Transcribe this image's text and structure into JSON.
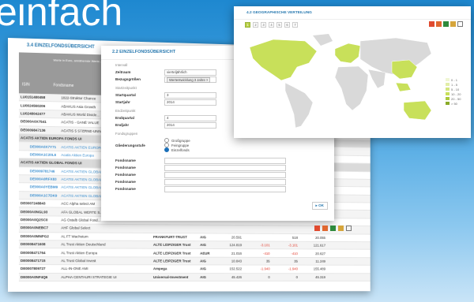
{
  "brand": {
    "text": "einfach"
  },
  "table_panel": {
    "title": "3.4 EINZELFONDSÜBERSICHT",
    "header_note": "Werte in Euro, annähernde Werte...",
    "col_isin": "ISIN",
    "col_name": "Fondsname",
    "rows": [
      {
        "type": "row",
        "isin": "LU0151480458",
        "name": "1822-Struktur Chance",
        "kag": "",
        "cur": "",
        "v1": "",
        "v2": "",
        "v3": "",
        "v4": ""
      },
      {
        "type": "row",
        "isin": "LU0024560206",
        "name": "ABAKUS Asia Growth",
        "kag": "",
        "cur": "",
        "v1": "",
        "v2": "",
        "v3": "",
        "v4": ""
      },
      {
        "type": "row",
        "isin": "LU0248042477",
        "name": "ABAKUS World Divide...",
        "kag": "",
        "cur": "",
        "v1": "",
        "v2": "",
        "v3": "",
        "v4": ""
      },
      {
        "type": "row",
        "isin": "DE000A0X7541",
        "name": "ACATIS - GANÉ VALUE",
        "kag": "",
        "cur": "",
        "v1": "",
        "v2": "",
        "v3": "",
        "v4": ""
      },
      {
        "type": "row",
        "isin": "DE0009847136",
        "name": "ACATIS 5 STERNE-UNIV...",
        "kag": "",
        "cur": "",
        "v1": "",
        "v2": "",
        "v3": "",
        "v4": ""
      },
      {
        "type": "grp",
        "isin": "ACATIS AKTIEN EUROPA FONDS UI"
      },
      {
        "type": "sub",
        "isin": "DE000A0X7Y71",
        "name": "ACATIS AKTIEN EUROPA",
        "kag": "",
        "cur": "",
        "v1": "",
        "v2": "",
        "v3": "",
        "v4": ""
      },
      {
        "type": "sub",
        "isin": "DE000A1C20L6",
        "name": "Acatis Aktien Europa",
        "kag": "",
        "cur": "",
        "v1": "",
        "v2": "",
        "v3": "",
        "v4": ""
      },
      {
        "type": "grp",
        "isin": "ACATIS AKTIEN GLOBAL FONDS UI"
      },
      {
        "type": "sub",
        "isin": "DE0009781746",
        "name": "ACATIS AKTIEN GLOBAL",
        "kag": "",
        "cur": "",
        "v1": "",
        "v2": "",
        "v3": "",
        "v4": ""
      },
      {
        "type": "sub",
        "isin": "DE000A0RFX83",
        "name": "ACATIS AKTIEN GLOBAL",
        "kag": "",
        "cur": "",
        "v1": "",
        "v2": "",
        "v3": "",
        "v4": ""
      },
      {
        "type": "sub",
        "isin": "DE000A0YEBM9",
        "name": "ACATIS AKTIEN GLOBAL",
        "kag": "",
        "cur": "",
        "v1": "",
        "v2": "",
        "v3": "",
        "v4": ""
      },
      {
        "type": "sub",
        "isin": "DE000A1C7DK9",
        "name": "ACATIS AKTIEN GLOBAL",
        "kag": "",
        "cur": "",
        "v1": "",
        "v2": "",
        "v3": "",
        "v4": ""
      },
      {
        "type": "row",
        "isin": "DE0007248843",
        "name": "ACC Alpha select AM",
        "kag": "",
        "cur": "",
        "v1": "",
        "v2": "",
        "v3": "",
        "v4": ""
      },
      {
        "type": "row",
        "isin": "DE000A0NGL93",
        "name": "AFA GLOBAL WERTE S...",
        "kag": "",
        "cur": "",
        "v1": "",
        "v2": "",
        "v3": "",
        "v4": ""
      },
      {
        "type": "row",
        "isin": "DE000A0Q2SC0",
        "name": "AG Ostalb Global Fond...",
        "kag": "",
        "cur": "",
        "v1": "",
        "v2": "",
        "v3": "",
        "v4": ""
      },
      {
        "type": "row",
        "isin": "DE000A0NEBC7",
        "name": "AHF Global Select",
        "kag": "",
        "cur": "",
        "v1": "",
        "v2": "",
        "v3": "",
        "v4": ""
      },
      {
        "type": "row",
        "isin": "DE000A0MNPG2",
        "name": "AL FT Wachstum",
        "kag": "FRANKFURT-TRUST",
        "cur": "AIG",
        "v1": "20.591",
        "v2": "",
        "v3": "518",
        "v4": "20.055"
      },
      {
        "type": "row",
        "isin": "DE0008471608",
        "name": "AL Trust Aktien Deutschland",
        "kag": "ALTE LEIPZIGER Trust",
        "cur": "AIG",
        "v1": "124.819",
        "v2": "-3.101",
        "v3": "-3.101",
        "v4": "121.617"
      },
      {
        "type": "row",
        "isin": "DE0008471764",
        "name": "AL Trust Aktien Europa",
        "kag": "ALTE LEIPZIGER Trust",
        "cur": "AEUR",
        "v1": "21.016",
        "v2": "-410",
        "v3": "-410",
        "v4": "20.627"
      },
      {
        "type": "row",
        "isin": "DE0008471715",
        "name": "AL Trust Global Invest",
        "kag": "ALTE LEIPZIGER Trust",
        "cur": "AIG",
        "v1": "10.843",
        "v2": "35",
        "v3": "35",
        "v4": "11.249"
      },
      {
        "type": "row",
        "isin": "DE0007809727",
        "name": "ALL-IN-ONE AMI",
        "kag": "Ampega",
        "cur": "AIG",
        "v1": "152.522",
        "v2": "-1.940",
        "v3": "-1.940",
        "v4": "155.489"
      },
      {
        "type": "row",
        "isin": "DE000A0NF4Q6",
        "name": "ALPHA CENTAURI STRATEGIE UI",
        "kag": "Universal-Investment",
        "cur": "AIG",
        "v1": "45.426",
        "v2": "0",
        "v3": "0",
        "v4": "45.319"
      }
    ]
  },
  "form_panel": {
    "title": "2.2 EINZELFONDSÜBERSICHT",
    "sec_interval": "Intervall",
    "lbl_zeitraum": "Zeitraum",
    "val_zeitraum": "vierteljährlich",
    "lbl_bezug": "Bezugsgrößen",
    "val_bezug": "Wertentwicklung 3 Jahre",
    "sec_start": "Startzeitpunkt",
    "lbl_startquartal": "Startquartal",
    "val_startquartal": "3",
    "lbl_startjahr": "Startjahr",
    "val_startjahr": "2014",
    "sec_end": "Endzeitpunkt",
    "lbl_endquartal": "Endquartal",
    "val_endquartal": "4",
    "lbl_endjahr": "Endjahr",
    "val_endjahr": "2014",
    "sec_groups": "Fondsgruppen",
    "lbl_gliederung": "Gliederungsstufe",
    "radios": [
      "Großgruppe",
      "Feingruppe",
      "Einzelfonds"
    ],
    "lbl_fondsname": "Fondsname",
    "ok": "OK"
  },
  "map_panel": {
    "title": "4.2 GEOGRAPHISCHE VERTEILUNG",
    "tabs": [
      "1",
      "2",
      "3",
      "4",
      "5",
      "6",
      "7"
    ],
    "legend": [
      "0 - 1",
      "1 - 5",
      "5 - 10",
      "10 - 20",
      "20 - 50",
      "> 50"
    ]
  },
  "colors": {
    "map_highlight": "#c8e05a",
    "map_base": "#d9d9d9",
    "link": "#2a7ab0",
    "negative": "#e23b2c"
  }
}
